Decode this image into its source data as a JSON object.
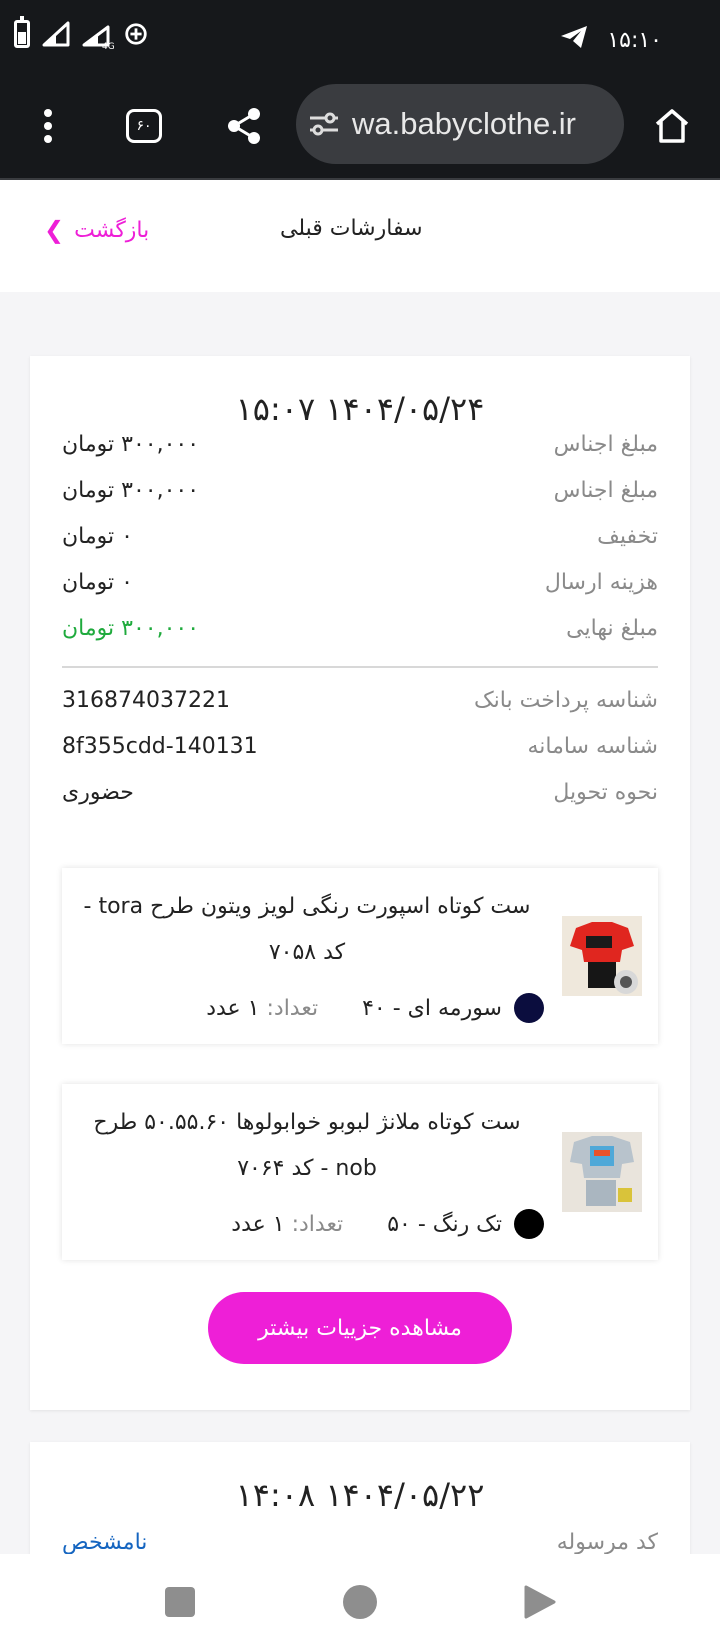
{
  "status_bar": {
    "time": "۱۵:۱۰",
    "network": "4G",
    "icons": [
      "battery-icon",
      "signal-icon",
      "signal-4g-icon",
      "data-saver-icon",
      "telegram-icon"
    ]
  },
  "browser": {
    "url": "wa.babyclothe.ir",
    "tab_count": "۶۰",
    "icons": [
      "menu-dots-icon",
      "tabs-icon",
      "share-icon",
      "site-settings-icon",
      "home-icon"
    ]
  },
  "header": {
    "title": "سفارشات قبلی",
    "back_label": "بازگشت"
  },
  "orders": [
    {
      "date": "۱۴۰۴/۰۵/۲۴ ۱۵:۰۷",
      "rows": [
        {
          "label": "مبلغ اجناس",
          "value": "۳۰۰,۰۰۰ تومان"
        },
        {
          "label": "مبلغ اجناس",
          "value": "۳۰۰,۰۰۰ تومان"
        },
        {
          "label": "تخفیف",
          "value": "۰ تومان"
        },
        {
          "label": "هزینه ارسال",
          "value": "۰ تومان"
        },
        {
          "label": "مبلغ نهایی",
          "value": "۳۰۰,۰۰۰ تومان"
        }
      ],
      "rows2": [
        {
          "label": "شناسه پرداخت بانک",
          "value": "316874037221"
        },
        {
          "label": "شناسه سامانه",
          "value": "8f355cdd-140131"
        },
        {
          "label": "نحوه تحویل",
          "value": "حضوری"
        }
      ],
      "products": [
        {
          "name": "ست کوتاه اسپورت رنگی لویز ویتون طرح tora - کد ۷۰۵۸",
          "color_hex": "#0b0d3e",
          "variant": "سورمه ای  - ۴۰",
          "qty_label": "تعداد:",
          "qty_value": "۱ عدد"
        },
        {
          "name": "ست کوتاه ملانژ لبوبو خوابولوها ۵۰.۵۵.۶۰ طرح nob - کد ۷۰۶۴",
          "color_hex": "#000000",
          "variant": "تک رنگ  - ۵۰",
          "qty_label": "تعداد:",
          "qty_value": "۱ عدد"
        }
      ],
      "details_button": "مشاهده جزییات بیشتر"
    },
    {
      "date": "۱۴۰۴/۰۵/۲۲ ۱۴:۰۸",
      "rows": [
        {
          "label": "کد مرسوله",
          "value": "نامشخص"
        }
      ]
    }
  ],
  "nav": {
    "icons": [
      "recents-icon",
      "home-icon",
      "back-icon"
    ]
  },
  "colors": {
    "accent": "#ee1fd7",
    "success": "#1faa3d",
    "link": "#1565c0",
    "chrome_bg": "#16181b"
  }
}
